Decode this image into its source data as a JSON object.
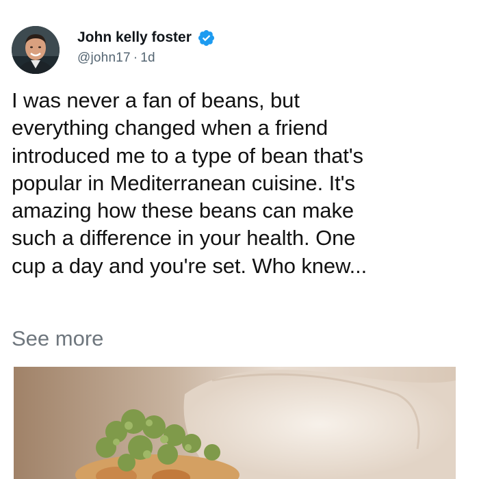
{
  "author": {
    "name": "John kelly foster",
    "handle": "@john17",
    "separator": "·",
    "time": "1d",
    "verified": true,
    "avatar_icon": "profile-photo",
    "verified_icon": "verified-badge-icon"
  },
  "tweet": {
    "lines": [
      "I was never a fan of beans, but",
      "everything changed when a friend",
      "introduced me to a type of bean that's",
      "popular in Mediterranean cuisine. It's",
      "amazing how these beans can make",
      "such a difference in your health. One",
      "cup a day and you're set. Who knew..."
    ],
    "see_more": "See more"
  },
  "colors": {
    "verified_blue": "#1d9bf0",
    "meta_gray": "#536471",
    "see_more_gray": "#6e767d",
    "text": "#111111"
  },
  "media": {
    "type": "photo",
    "subject": "food-dish-with-greens-garnish"
  }
}
